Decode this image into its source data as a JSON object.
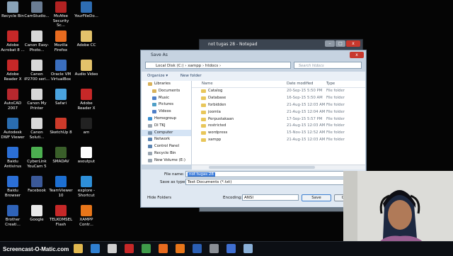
{
  "desktop_icons": [
    {
      "label": "Recycle Bin",
      "color": "#8aa3b8"
    },
    {
      "label": "CamStudio...",
      "color": "#6a7c92"
    },
    {
      "label": "McAfee Security Sc...",
      "color": "#b22222"
    },
    {
      "label": "YourFileDo...",
      "color": "#2e6db3"
    },
    {
      "label": "Adobe Acrobat 8 ...",
      "color": "#c62828"
    },
    {
      "label": "Canon Easy-Photo...",
      "color": "#d8d8d8"
    },
    {
      "label": "Mozilla Firefox",
      "color": "#e86b1f"
    },
    {
      "label": "Adobe CC",
      "color": "#e3c26b"
    },
    {
      "label": "Adobe Reader X",
      "color": "#c62828"
    },
    {
      "label": "Canon iP2700 seri...",
      "color": "#d8d8d8"
    },
    {
      "label": "Oracle VM VirtualBox",
      "color": "#3b6fbf"
    },
    {
      "label": "Audio Video",
      "color": "#e3c26b"
    },
    {
      "label": "AutoCAD 2007",
      "color": "#b7282e"
    },
    {
      "label": "Canon My Printer",
      "color": "#d8d8d8"
    },
    {
      "label": "Safari",
      "color": "#4aa3df"
    },
    {
      "label": "Adobe Reader X",
      "color": "#c62828"
    },
    {
      "label": "Autodesk DWF Viewer",
      "color": "#2a6db0"
    },
    {
      "label": "Canon Soluti...",
      "color": "#d8d8d8"
    },
    {
      "label": "SketchUp 8",
      "color": "#cc3a2a"
    },
    {
      "label": "am",
      "color": "#222222"
    },
    {
      "label": "Baidu Antivirus",
      "color": "#2b6fd6"
    },
    {
      "label": "CyberLink YouCam 5",
      "color": "#4caf50"
    },
    {
      "label": "SMADAV",
      "color": "#3a5f2a"
    },
    {
      "label": "asoutput",
      "color": "#ffffff"
    },
    {
      "label": "Baidu Browser",
      "color": "#2b6fd6"
    },
    {
      "label": "Facebook",
      "color": "#3b5998"
    },
    {
      "label": "TeamViewer 10",
      "color": "#1d6fd1"
    },
    {
      "label": "explore - Shortcut",
      "color": "#2e8fd8"
    },
    {
      "label": "Brother Creati...",
      "color": "#2f63b8"
    },
    {
      "label": "Google",
      "color": "#e8e8e8"
    },
    {
      "label": "TELKOMSEL Flash",
      "color": "#c62828"
    },
    {
      "label": "XAMPP Contr...",
      "color": "#e8761a"
    }
  ],
  "notepad": {
    "title": "not tugas 28 - Notepad",
    "close_label": "x"
  },
  "save_dialog": {
    "title": "Save As",
    "address": "Local Disk (C:)  ›  xampp  ›  htdocs  ›",
    "search_placeholder": "Search htdocs",
    "toolbar": {
      "organize": "Organize ▾",
      "new_folder": "New folder"
    },
    "nav_items": [
      {
        "label": "Libraries",
        "color": "#d9b25a",
        "sub": false,
        "selected": false
      },
      {
        "label": "Documents",
        "color": "#d9b25a",
        "sub": true,
        "selected": false
      },
      {
        "label": "Music",
        "color": "#4f7fc7",
        "sub": true,
        "selected": false
      },
      {
        "label": "Pictures",
        "color": "#4f9fc7",
        "sub": true,
        "selected": false
      },
      {
        "label": "Videos",
        "color": "#4f7fc7",
        "sub": true,
        "selected": false
      },
      {
        "label": "Homegroup",
        "color": "#3a8fd0",
        "sub": false,
        "selected": false
      },
      {
        "label": "DI TKJ",
        "color": "#9aa6b2",
        "sub": false,
        "selected": false
      },
      {
        "label": "Computer",
        "color": "#7d95ad",
        "sub": false,
        "selected": true
      },
      {
        "label": "Network",
        "color": "#5b84b1",
        "sub": false,
        "selected": false
      },
      {
        "label": "Control Panel",
        "color": "#5b84b1",
        "sub": false,
        "selected": false
      },
      {
        "label": "Recycle Bin",
        "color": "#9aa6b2",
        "sub": false,
        "selected": false
      },
      {
        "label": "New Volume (E:)",
        "color": "#9aa6b2",
        "sub": false,
        "selected": false
      }
    ],
    "columns": {
      "name": "Name",
      "date": "Date modified",
      "type": "Type"
    },
    "files": [
      {
        "name": "Catalog",
        "date": "20-Sep-15 5:50 PM",
        "type": "File folder"
      },
      {
        "name": "Database",
        "date": "16-Sep-15 5:50 AM",
        "type": "File folder"
      },
      {
        "name": "forbidden",
        "date": "21-Aug-15 12:03 AM",
        "type": "File folder"
      },
      {
        "name": "joomla",
        "date": "21-Aug-15 12:04 AM",
        "type": "File folder"
      },
      {
        "name": "Perpustakaan",
        "date": "17-Sep-15 5:57 PM",
        "type": "File folder"
      },
      {
        "name": "restricted",
        "date": "21-Aug-15 12:03 AM",
        "type": "File folder"
      },
      {
        "name": "wordpress",
        "date": "15-Nov-15 12:52 AM",
        "type": "File folder"
      },
      {
        "name": "xampp",
        "date": "21-Aug-15 12:03 AM",
        "type": "File folder"
      }
    ],
    "file_name_label": "File name:",
    "file_name_value": "not tugas 28",
    "save_type_label": "Save as type:",
    "save_type_value": "Text Documents (*.txt)",
    "encoding_label": "Encoding:",
    "encoding_value": "ANSI",
    "hide_folders": "Hide Folders",
    "save_button": "Save",
    "cancel_button": "Cancel"
  },
  "taskbar": {
    "watermark": "Screencast-O-Matic.com",
    "items": [
      {
        "name": "explorer",
        "color": "#e1b84f"
      },
      {
        "name": "media-player",
        "color": "#2f7fd0"
      },
      {
        "name": "film",
        "color": "#cfcfcf"
      },
      {
        "name": "acrobat",
        "color": "#c62828"
      },
      {
        "name": "chrome",
        "color": "#3f9b4a"
      },
      {
        "name": "firefox",
        "color": "#e86b1f"
      },
      {
        "name": "xampp",
        "color": "#e8761a"
      },
      {
        "name": "word",
        "color": "#2b5fb3"
      },
      {
        "name": "tool",
        "color": "#8a8f96"
      },
      {
        "name": "recorder",
        "color": "#3f6fd1"
      },
      {
        "name": "notepad",
        "color": "#8ab0d8"
      }
    ]
  }
}
